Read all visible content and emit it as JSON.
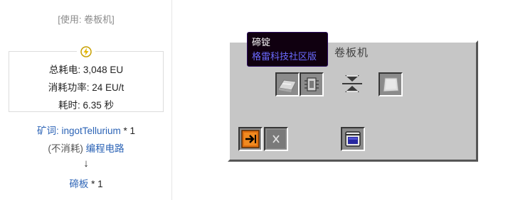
{
  "usage_label": "[使用: 卷板机]",
  "energy": {
    "icon": "lightning-icon",
    "total_label": "总耗电: 3,048 EU",
    "power_label": "消耗功率: 24 EU/t",
    "time_label": "耗时: 6.35 秒"
  },
  "recipe": {
    "ore_prefix": "矿词: ",
    "ore_name": "ingotTellurium",
    "ore_qty": " * 1",
    "nc_prefix": "(不消耗) ",
    "circuit": "编程电路",
    "arrow": "↓",
    "output_name": "碲板",
    "output_qty": " * 1"
  },
  "gui": {
    "title": "卷板机",
    "tooltip": {
      "title": "碲锭",
      "mod": "格雷科技社区版"
    },
    "slots": {
      "input": "tellurium-ingot-icon",
      "circuit": "circuit-icon",
      "progress": "press-progress-icon",
      "output": "tellurium-plate-icon",
      "output_toggle": "auto-output-icon",
      "input_toggle": "disabled-x-icon",
      "battery": "battery-icon"
    }
  },
  "colors": {
    "link": "#2a62b5",
    "gui_bg": "#c6c6c6",
    "tooltip_mod": "#6b6bff"
  }
}
